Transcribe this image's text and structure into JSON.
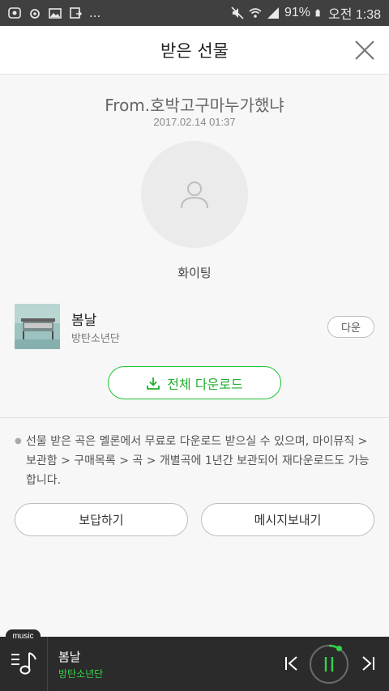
{
  "status_bar": {
    "dots": "...",
    "battery": "91%",
    "time": "오전 1:38"
  },
  "header": {
    "title": "받은 선물",
    "close_icon": "close-icon"
  },
  "gift": {
    "from": "From.호박고구마누가했냐",
    "date": "2017.02.14 01:37",
    "message": "화이팅"
  },
  "song": {
    "title": "봄날",
    "artist": "방탄소년단",
    "download_label": "다운"
  },
  "download_all_label": "전체 다운로드",
  "notice": "선물 받은 곡은 멜론에서 무료로 다운로드 받으실 수 있으며, 마이뮤직 > 보관함 > 구매목록 > 곡 > 개별곡에 1년간 보관되어 재다운로드도 가능합니다.",
  "buttons": {
    "reply": "보답하기",
    "send_message": "메시지보내기"
  },
  "player": {
    "tab_label": "music",
    "title": "봄날",
    "artist": "방탄소년단",
    "accent": "#35d24a"
  },
  "colors": {
    "accent_green": "#20c532",
    "header_bg": "#ffffff",
    "page_bg": "#f7f7f7"
  }
}
